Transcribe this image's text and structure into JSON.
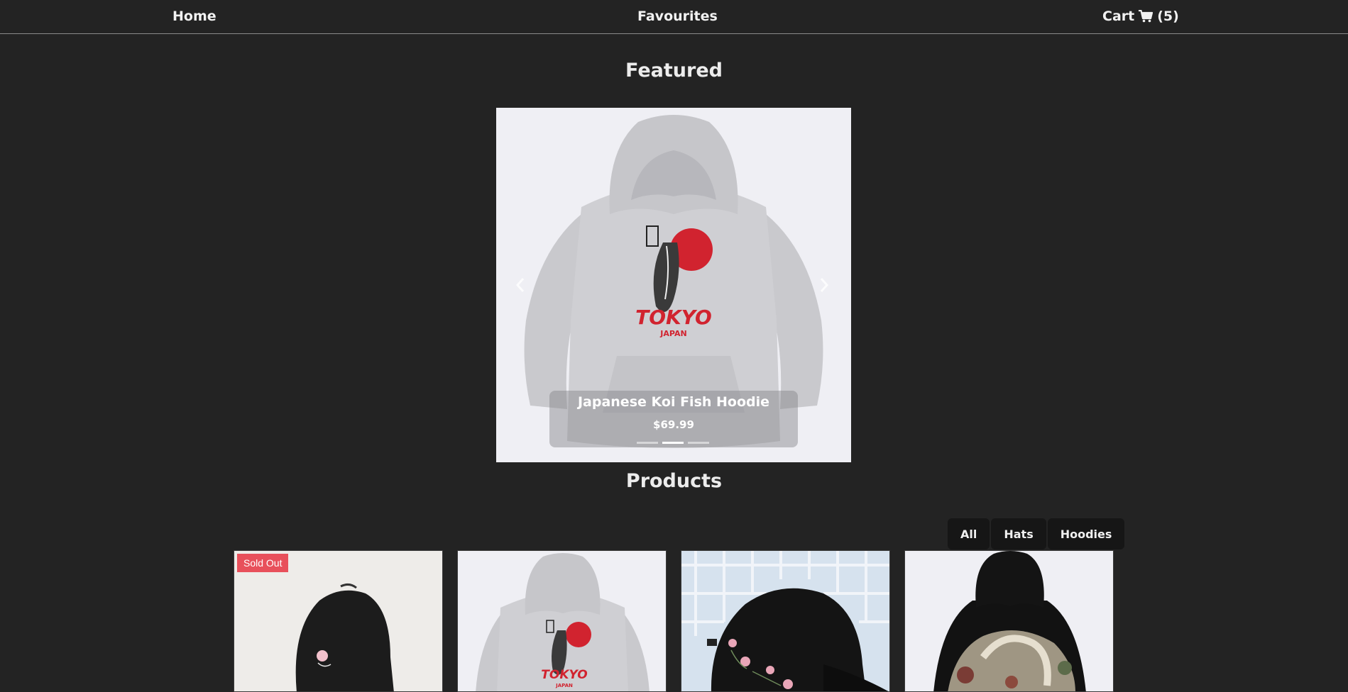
{
  "nav": {
    "home_label": "Home",
    "favourites_label": "Favourites",
    "cart_label": "Cart",
    "cart_count": "(5)"
  },
  "featured": {
    "title": "Featured",
    "slide": {
      "name": "Japanese Koi Fish Hoodie",
      "price": "$69.99",
      "print_text": "TOKYO",
      "print_subtext": "JAPAN"
    },
    "active_slide_index": 1,
    "slide_count": 3
  },
  "products": {
    "title": "Products",
    "filters": [
      "All",
      "Hats",
      "Hoodies"
    ],
    "cards": [
      {
        "badge": "Sold Out",
        "image_icon": "black-cap-image"
      },
      {
        "image_icon": "grey-koi-hoodie-image",
        "print_text": "TOKYO",
        "print_subtext": "JAPAN"
      },
      {
        "image_icon": "black-floral-cap-image"
      },
      {
        "image_icon": "black-crane-hoodie-image"
      }
    ]
  },
  "colors": {
    "background": "#232323",
    "text": "#f0f0f0",
    "badge": "#e8505b",
    "print_red": "#d1232f"
  }
}
